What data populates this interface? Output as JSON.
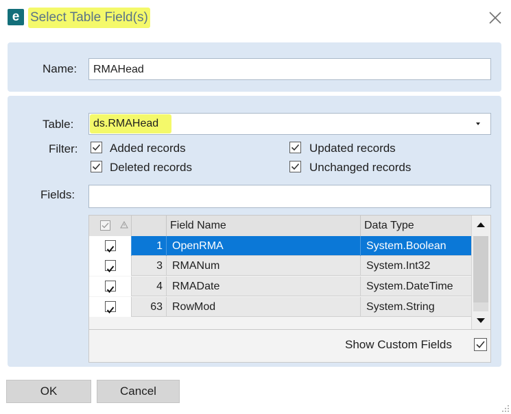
{
  "window": {
    "title": "Select Table Field(s)",
    "logo_letter": "e",
    "close_icon": "close-icon"
  },
  "name_field": {
    "label": "Name:",
    "value": "RMAHead"
  },
  "table_field": {
    "label": "Table:",
    "value": "ds.RMAHead"
  },
  "filter": {
    "label": "Filter:",
    "options": [
      {
        "label": "Added records",
        "checked": true
      },
      {
        "label": "Deleted records",
        "checked": true
      },
      {
        "label": "Updated records",
        "checked": true
      },
      {
        "label": "Unchanged records",
        "checked": true
      }
    ]
  },
  "fields_field": {
    "label": "Fields:",
    "value": ""
  },
  "grid": {
    "columns": [
      "",
      "",
      "Field Name",
      "Data Type"
    ],
    "rows": [
      {
        "checked": true,
        "num": "1",
        "field": "OpenRMA",
        "type": "System.Boolean",
        "selected": true
      },
      {
        "checked": true,
        "num": "3",
        "field": "RMANum",
        "type": "System.Int32",
        "selected": false
      },
      {
        "checked": true,
        "num": "4",
        "field": "RMADate",
        "type": "System.DateTime",
        "selected": false
      },
      {
        "checked": true,
        "num": "63",
        "field": "RowMod",
        "type": "System.String",
        "selected": false
      }
    ]
  },
  "show_custom_fields": {
    "label": "Show Custom Fields",
    "checked": true
  },
  "buttons": {
    "ok": "OK",
    "cancel": "Cancel"
  },
  "colors": {
    "highlight": "#f4f96a",
    "panel": "#dce7f4",
    "selection": "#0b78d7",
    "logo": "#136f7a"
  }
}
